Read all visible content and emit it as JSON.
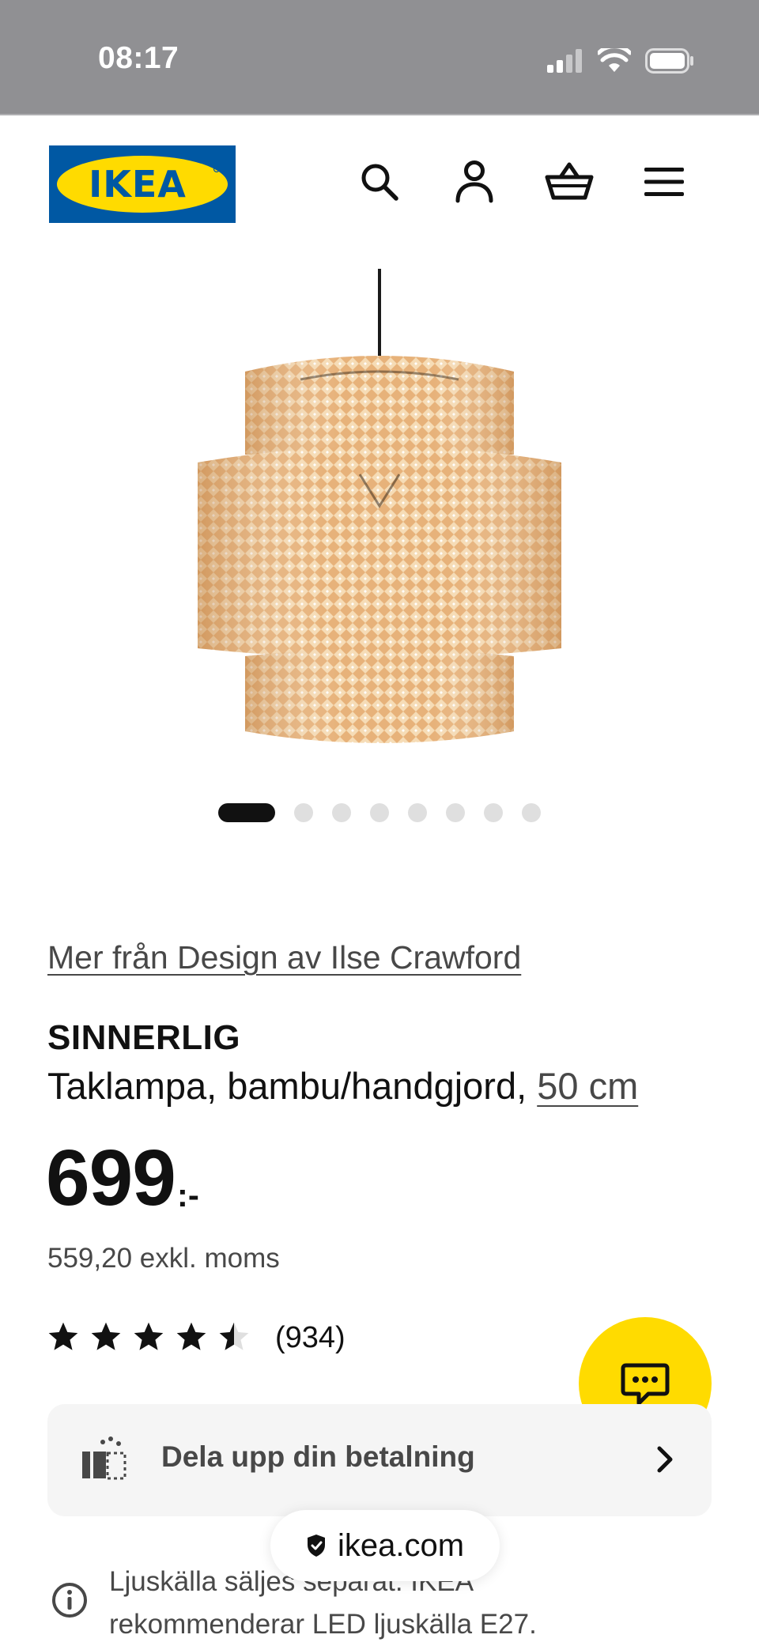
{
  "status_bar": {
    "time": "08:17",
    "icons": [
      "cellular-signal-icon",
      "wifi-icon",
      "battery-icon"
    ]
  },
  "header": {
    "logo_text": "IKEA",
    "icons": [
      "search-icon",
      "account-icon",
      "cart-icon",
      "menu-icon"
    ],
    "brand_colors": {
      "blue": "#0058a3",
      "yellow": "#ffdb00"
    }
  },
  "gallery": {
    "image_subject": "SINNERLIG bamboo pendant lamp",
    "total_images": 8,
    "active_index": 0
  },
  "product": {
    "designer_link": "Mer från Design av Ilse Crawford",
    "name": "SINNERLIG",
    "description": "Taklampa, bambu/handgjord,",
    "size": "50 cm",
    "price": "699",
    "price_suffix": ":-",
    "price_excl_vat": "559,20 exkl. moms",
    "rating": 4.5,
    "rating_max": 5,
    "review_count": "(934)"
  },
  "payment_banner": {
    "label": "Dela upp din betalning"
  },
  "info": {
    "text": "Ljuskälla säljes separat. IKEA rekommenderar LED ljuskälla E27."
  },
  "browser": {
    "url": "ikea.com"
  },
  "chat": {
    "icon": "chat-icon",
    "color": "#ffdb00"
  }
}
